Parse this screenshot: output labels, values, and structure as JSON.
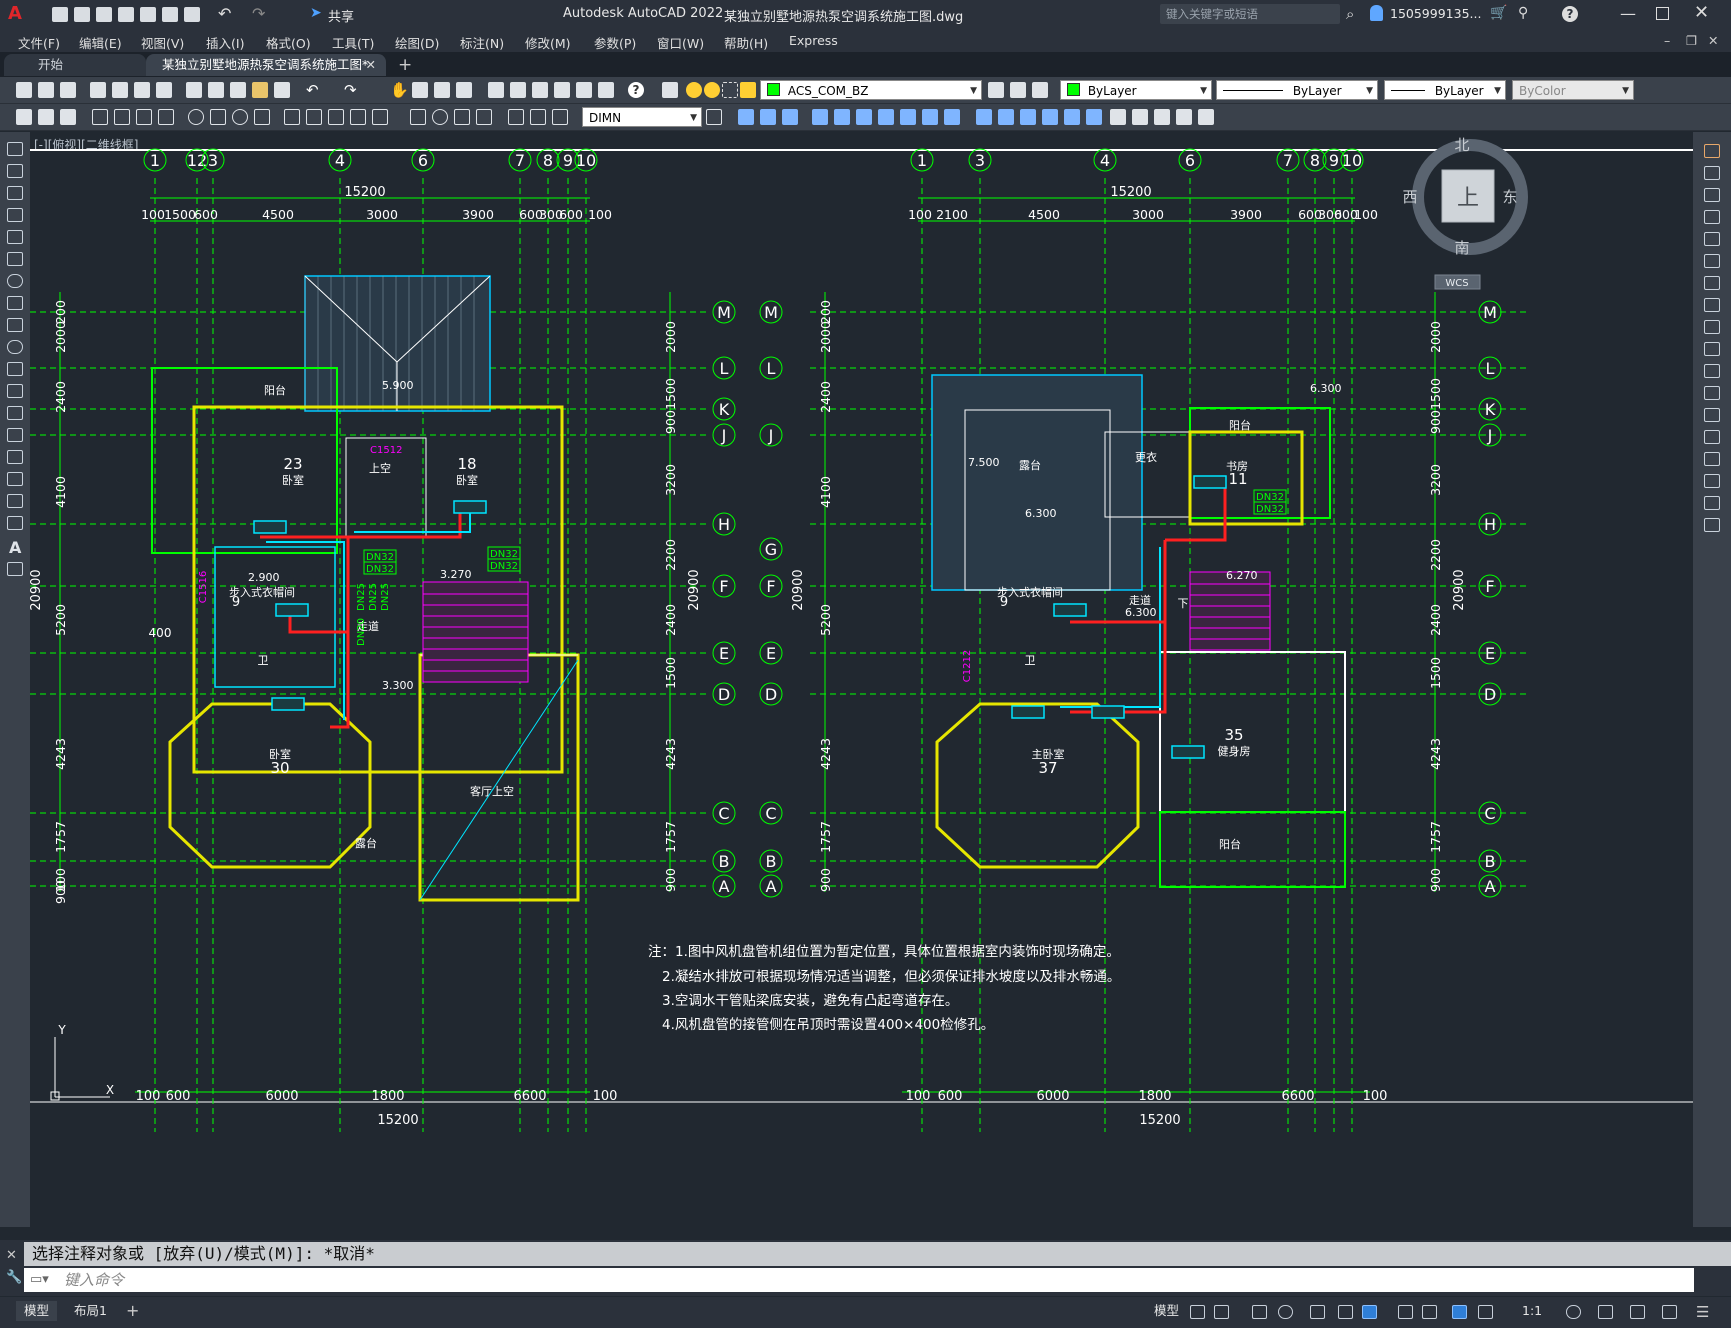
{
  "titlebar": {
    "app_title": "Autodesk AutoCAD 2022",
    "file_name": "某独立别墅地源热泵空调系统施工图.dwg",
    "share_label": "共享",
    "search_placeholder": "键入关键字或短语",
    "user_name": "1505999135..."
  },
  "menu": [
    "文件(F)",
    "编辑(E)",
    "视图(V)",
    "插入(I)",
    "格式(O)",
    "工具(T)",
    "绘图(D)",
    "标注(N)",
    "修改(M)",
    "参数(P)",
    "窗口(W)",
    "帮助(H)",
    "Express"
  ],
  "tabs": {
    "start": "开始",
    "active": "某独立别墅地源热泵空调系统施工图*"
  },
  "properties": {
    "layer": "ACS_COM_BZ",
    "color": "ByLayer",
    "linetype": "ByLayer",
    "lineweight": "ByLayer",
    "plotstyle": "ByColor",
    "dimstyle": "DIMN"
  },
  "viewport_label": "[-][俯视][二维线框]",
  "viewcube": {
    "north": "北",
    "south": "南",
    "east": "东",
    "west": "西",
    "top": "上",
    "wcs": "WCS"
  },
  "drawing": {
    "col_labels": [
      "1",
      "12",
      "3",
      "4",
      "6",
      "7",
      "8",
      "9",
      "10"
    ],
    "col_labels_right": [
      "1",
      "3",
      "4",
      "6",
      "7",
      "8",
      "9",
      "10"
    ],
    "row_labels": [
      "M",
      "L",
      "K",
      "J",
      "H",
      "F",
      "E",
      "D",
      "C",
      "B",
      "A"
    ],
    "row_labels_left_right": [
      "M",
      "L",
      "J",
      "G",
      "F",
      "E",
      "D",
      "C",
      "B",
      "A"
    ],
    "row_labels_far_right": [
      "M",
      "L",
      "K",
      "J",
      "H",
      "F",
      "E",
      "D",
      "C",
      "B",
      "A"
    ],
    "total_width": "15200",
    "top_dims_left": [
      "100",
      "1500",
      "600",
      "4500",
      "3000",
      "3900",
      "600",
      "300",
      "600",
      "100"
    ],
    "top_dims_right": [
      "100",
      "2100",
      "4500",
      "3000",
      "3900",
      "600",
      "300",
      "600",
      "100"
    ],
    "left_dims": [
      "2000",
      "200",
      "2400",
      "4100",
      "5200",
      "4243",
      "1757",
      "100",
      "900"
    ],
    "left_dims_mid": [
      "2000",
      "1500",
      "900",
      "3200",
      "2200",
      "2400",
      "1500",
      "4243",
      "1757",
      "900"
    ],
    "mid_dims": [
      "2000",
      "200",
      "2400",
      "4100",
      "5200",
      "4243",
      "1757",
      "900"
    ],
    "total_height": "20900",
    "bottom_dims": [
      "100",
      "600",
      "6000",
      "1800",
      "6600",
      "100"
    ],
    "bottom_total": "15200",
    "side_dim_left": "400",
    "rooms_left": {
      "balcony": "阳台",
      "bedroom1_no": "23",
      "bedroom1": "卧室",
      "void": "上空",
      "bedroom2_no": "18",
      "bedroom2": "卧室",
      "closet": "步入式衣帽间",
      "toilet": "卫",
      "corridor": "走道",
      "bedroom3": "卧室",
      "bedroom3_no": "30",
      "terrace": "露台",
      "living_void": "客厅上空",
      "elev1": "2.900",
      "elev2": "3.300",
      "elev3": "3.270",
      "elev4": "5.900",
      "dn32": "DN32",
      "dn25": "DN25",
      "dn20": "DN20",
      "tag_c1512": "C1512",
      "tag_c1516": "C1516",
      "room_no_9": "9"
    },
    "rooms_right": {
      "terrace": "露台",
      "dressing": "更衣",
      "study": "书房",
      "study_no": "11",
      "balcony": "阳台",
      "closet": "步入式衣帽间",
      "toilet": "卫",
      "corridor": "走道",
      "master": "主卧室",
      "master_no": "37",
      "gym": "健身房",
      "gym_no": "35",
      "balcony2": "阳台",
      "elev1": "7.500",
      "elev2": "6.300",
      "elev3": "6.300",
      "elev4": "6.270",
      "elev5": "6.300",
      "down": "下",
      "room_no_9": "9",
      "tag_c1212": "C1212"
    },
    "notes": [
      "注：1.图中风机盘管机组位置为暂定位置，具体位置根据室内装饰时现场确定。",
      "2.凝结水排放可根据现场情况适当调整，但必须保证排水坡度以及排水畅通。",
      "3.空调水干管贴梁底安装，避免有凸起弯道存在。",
      "4.风机盘管的接管侧在吊顶时需设置400×400检修孔。"
    ]
  },
  "command": {
    "history": "选择注释对象或 [放弃(U)/模式(M)]: *取消*",
    "placeholder": "键入命令"
  },
  "layout_tabs": {
    "model": "模型",
    "layout1": "布局1"
  },
  "status": {
    "space": "模型",
    "scale": "1:1"
  },
  "colors": {
    "grid": "#00ff00",
    "pipe_red": "#ff2020",
    "pipe_cyan": "#00e5ff",
    "wall_yellow": "#e6e600",
    "magenta": "#ff00ff",
    "canvas": "#212830"
  }
}
